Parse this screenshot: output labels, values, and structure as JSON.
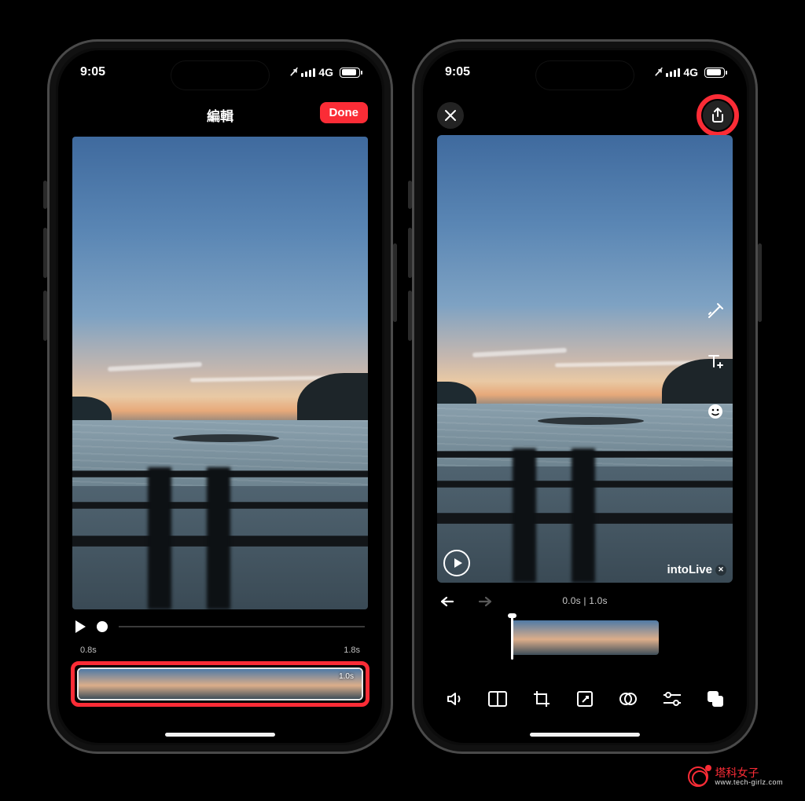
{
  "status": {
    "time": "9:05",
    "network": "4G"
  },
  "left": {
    "title": "編輯",
    "done": "Done",
    "time_start": "0.8s",
    "time_end": "1.8s",
    "timeline_duration": "1.0s"
  },
  "right": {
    "watermark_label": "intoLive",
    "time_current": "0.0s",
    "time_sep": " | ",
    "time_total": "1.0s"
  },
  "watermark": {
    "title": "塔科女子",
    "url": "www.tech-girlz.com"
  }
}
